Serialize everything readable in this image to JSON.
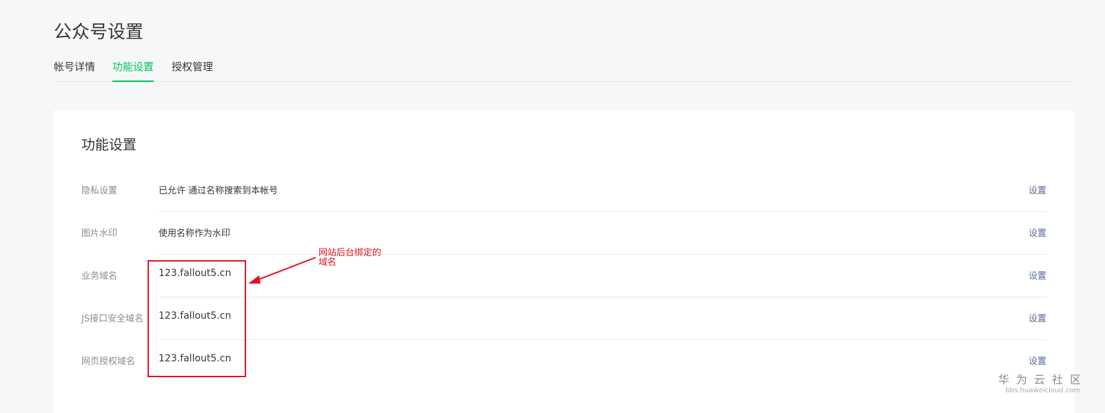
{
  "header": {
    "title": "公众号设置"
  },
  "tabs": [
    {
      "label": "帐号详情",
      "active": false
    },
    {
      "label": "功能设置",
      "active": true
    },
    {
      "label": "授权管理",
      "active": false
    }
  ],
  "card": {
    "title": "功能设置",
    "rows": [
      {
        "label": "隐私设置",
        "value": "已允许 通过名称搜索到本帐号",
        "action": "设置"
      },
      {
        "label": "图片水印",
        "value": "使用名称作为水印",
        "action": "设置"
      },
      {
        "label": "业务域名",
        "value": "123.fallout5.cn",
        "action": "设置"
      },
      {
        "label": "JS接口安全域名",
        "value": "123.fallout5.cn",
        "action": "设置"
      },
      {
        "label": "网页授权域名",
        "value": "123.fallout5.cn",
        "action": "设置"
      }
    ]
  },
  "annotation": {
    "line1": "网站后台绑定的",
    "line2": "域名",
    "color": "#e0141e"
  },
  "watermark": {
    "main": "华为云社区",
    "sub": "bbs.huaweicloud.com"
  },
  "colors": {
    "accent": "#07c160",
    "link": "#576b95",
    "annotation": "#e0141e"
  }
}
